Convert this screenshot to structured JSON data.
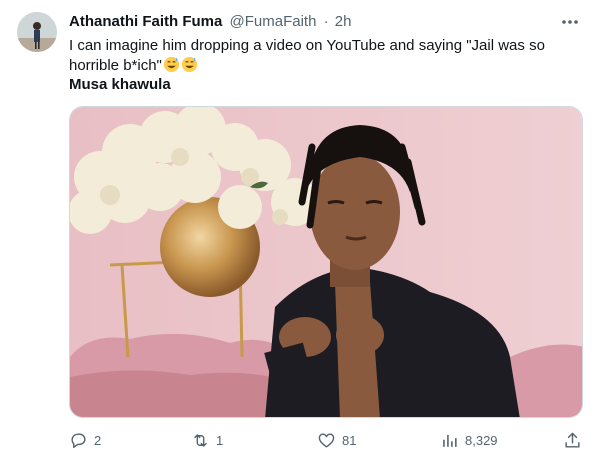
{
  "tweet": {
    "author_name": "Athanathi Faith Fuma",
    "handle": "@FumaFaith",
    "separator": "·",
    "time": "2h",
    "text": "I can imagine him dropping a video on YouTube and saying \"Jail was so horrible b*ich\"",
    "emoji": [
      "grinning-face-with-sweat",
      "grinning-face-with-sweat"
    ],
    "bold_line": "Musa khawula"
  },
  "actions": {
    "replies": "2",
    "retweets": "1",
    "likes": "81",
    "views": "8,329"
  },
  "colors": {
    "text": "#0f1419",
    "secondary": "#536471",
    "media_bg": "#ecc6cb"
  }
}
